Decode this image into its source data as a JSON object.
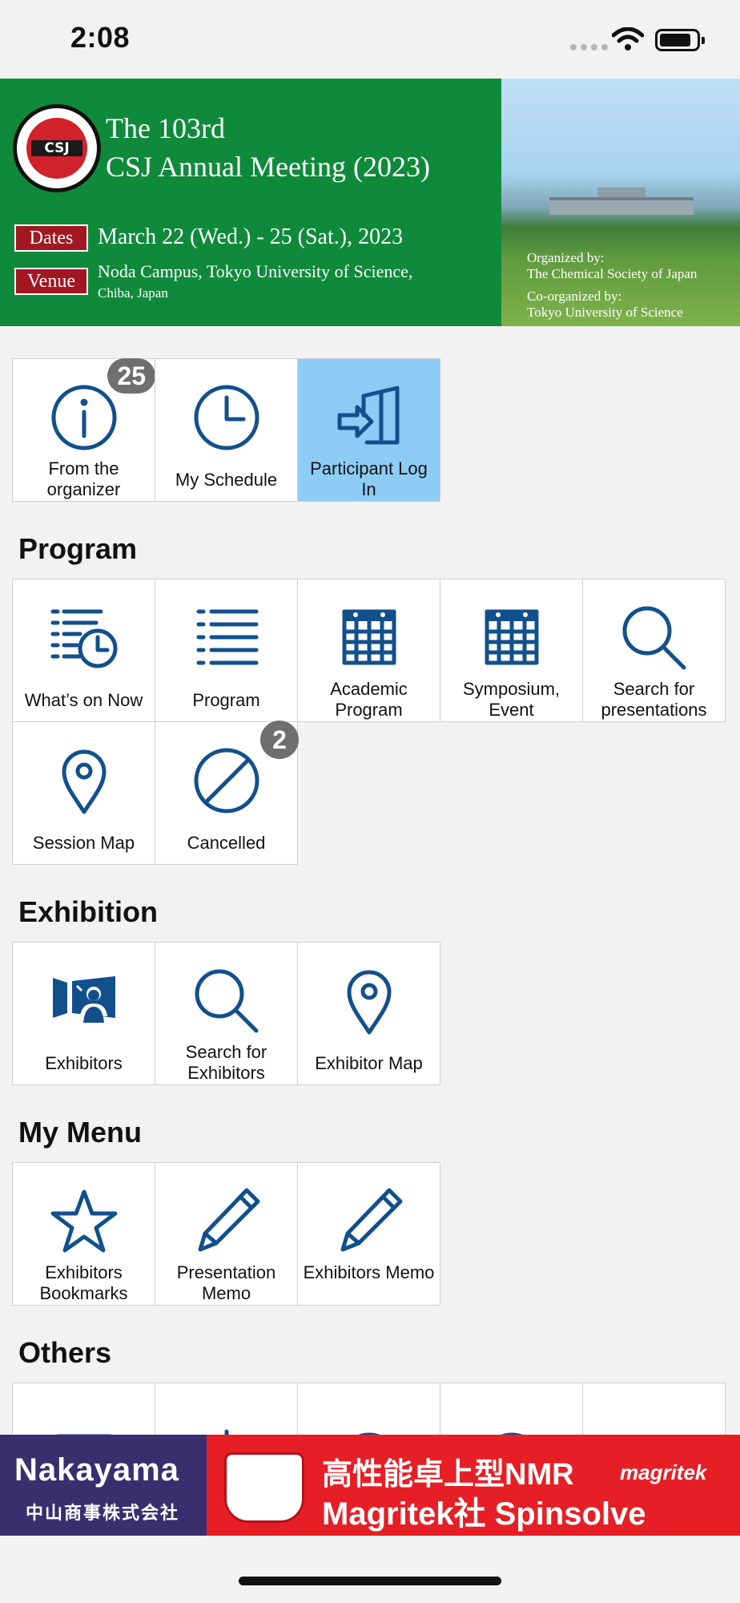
{
  "status_bar": {
    "time": "2:08"
  },
  "banner": {
    "title_line1": "The 103rd",
    "title_line2": "CSJ Annual Meeting (2023)",
    "logo_text": "CSJ",
    "dates_label": "Dates",
    "dates_value": "March 22 (Wed.) - 25 (Sat.), 2023",
    "venue_label": "Venue",
    "venue_value": "Noda Campus, Tokyo University of Science,",
    "venue_sub": "Chiba, Japan",
    "organized_by_label": "Organized by:",
    "organized_by": "The Chemical Society of Japan",
    "co_organized_label": "Co-organized by:",
    "co_organized_by": "Tokyo University of Science"
  },
  "top_tiles": [
    {
      "label": "From the organizer",
      "badge": "25",
      "icon": "info-icon"
    },
    {
      "label": "My Schedule",
      "icon": "clock-icon"
    },
    {
      "label": "Participant Log In",
      "icon": "login-icon",
      "active": true
    }
  ],
  "sections": {
    "program": {
      "title": "Program",
      "tiles": [
        {
          "label": "What’s on Now",
          "icon": "list-clock-icon"
        },
        {
          "label": "Program",
          "icon": "list-icon"
        },
        {
          "label": "Academic Program",
          "icon": "calendar-icon"
        },
        {
          "label": "Symposium, Event",
          "icon": "calendar-icon"
        },
        {
          "label": "Search for presentations",
          "icon": "search-icon"
        },
        {
          "label": "Session Map",
          "icon": "map-pin-icon"
        },
        {
          "label": "Cancelled",
          "badge": "2",
          "icon": "cancel-icon"
        }
      ]
    },
    "exhibition": {
      "title": "Exhibition",
      "tiles": [
        {
          "label": "Exhibitors",
          "icon": "exhibitor-icon"
        },
        {
          "label": "Search for Exhibitors",
          "icon": "search-icon"
        },
        {
          "label": "Exhibitor Map",
          "icon": "map-pin-icon"
        }
      ]
    },
    "my_menu": {
      "title": "My Menu",
      "tiles": [
        {
          "label": "Exhibitors Bookmarks",
          "icon": "star-icon"
        },
        {
          "label": "Presentation Memo",
          "icon": "pencil-icon"
        },
        {
          "label": "Exhibitors Memo",
          "icon": "pencil-icon"
        }
      ]
    },
    "others": {
      "title": "Others"
    }
  },
  "ad": {
    "brand": "Nakayama",
    "brand_jp": "中山商事株式会社",
    "line1": "高性能卓上型NMR",
    "line2": "Magritek社 Spinsolve",
    "logo": "magritek"
  },
  "colors": {
    "banner_green": "#0f8a3b",
    "icon_blue": "#12508c",
    "active_tile": "#8cccf5",
    "badge_gray": "#6f6f6f",
    "ad_red": "#e61f26"
  }
}
